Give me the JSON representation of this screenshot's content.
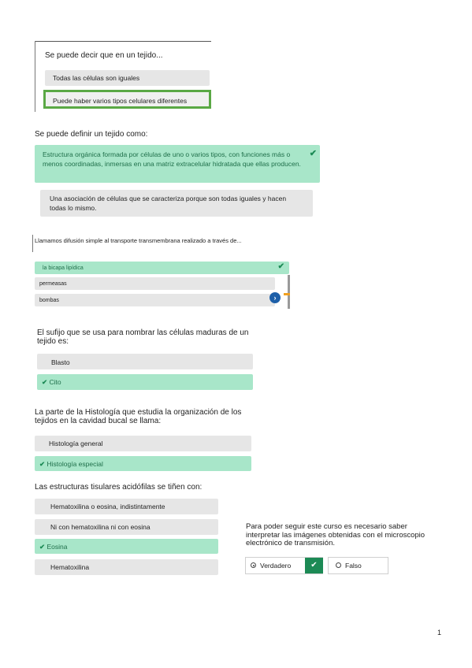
{
  "block1": {
    "question": "Se puede decir que en un tejido...",
    "options": [
      "Todas las células son iguales",
      "Puede haber varios tipos celulares diferentes"
    ]
  },
  "block2": {
    "question": "Se puede definir un tejido como:",
    "options": [
      "Estructura orgánica formada por células de uno o varios tipos, con funciones más o menos coordinadas, inmersas en una matriz extracelular hidratada que ellas producen.",
      "Una asociación de células que se caracteriza porque son todas iguales y hacen todas lo mismo."
    ]
  },
  "block3": {
    "question": "Llamamos difusión simple al transporte transmembrana realizado a través de...",
    "options": [
      "la bicapa lipídica",
      "permeasas",
      "bombas"
    ]
  },
  "block4": {
    "question": "El sufijo que se usa para nombrar las células maduras de un tejido es:",
    "options": [
      "Blasto",
      "Cito"
    ]
  },
  "block5": {
    "question": "La parte de la Histología que estudia la organización de los tejidos en la cavidad bucal se llama:",
    "options": [
      "Histología general",
      "Histología especial"
    ]
  },
  "block6": {
    "question": "Las estructuras tisulares acidófilas se tiñen con:",
    "options": [
      "Hematoxilina o eosina, indistintamente",
      "Ni con hematoxilina ni con eosina",
      "Eosina",
      "Hematoxilina"
    ]
  },
  "block7": {
    "question": "Para poder seguir este curso es necesario saber interpretar las imágenes obtenidas con el microscopio electrónico de transmisión.",
    "true_label": "Verdadero",
    "false_label": "Falso"
  },
  "page_number": "1",
  "colors": {
    "correct_bg": "#a8e6c9",
    "correct_text": "#1f6f4a",
    "check": "#1c8a55",
    "selected_border": "#5aa845",
    "option_bg": "#e6e6e6"
  },
  "icons": [
    "check-icon",
    "chevron-right-icon",
    "radio-selected-icon",
    "radio-empty-icon"
  ]
}
